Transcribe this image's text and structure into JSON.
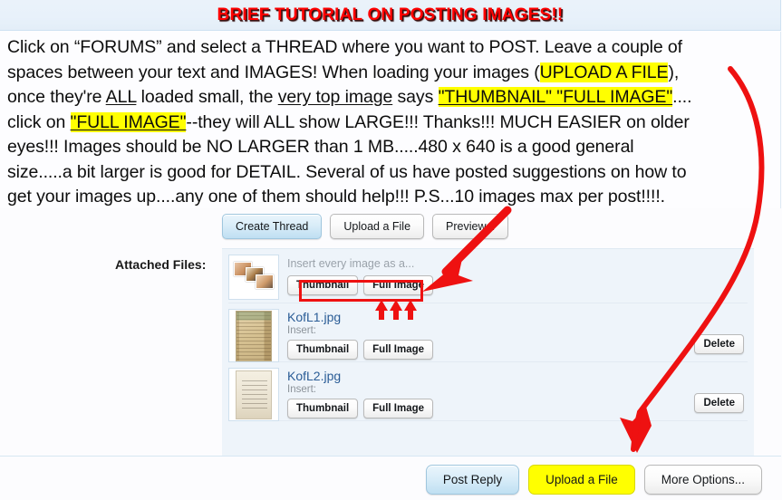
{
  "title": "BRIEF TUTORIAL ON POSTING IMAGES!!",
  "title_color": "#ff0000",
  "highlight_color": "#ffff00",
  "annotation_color": "#ee1111",
  "body_lines": {
    "l1": "Click on “FORUMS” and select a THREAD where you want to POST.  Leave a couple of",
    "l2_a": "spaces between your text and IMAGES!  When loading your images (",
    "l2_hl": "UPLOAD A FILE",
    "l2_b": "),",
    "l3_a": "once they're ",
    "l3_ul1": "ALL",
    "l3_b": " loaded small, the ",
    "l3_ul2": "very top image",
    "l3_c": " says ",
    "l3_hl": "\"THUMBNAIL\" \"FULL IMAGE\"",
    "l3_d": "....",
    "l4_a": "click on ",
    "l4_hl": "\"FULL IMAGE\"",
    "l4_b": "--they will ALL show LARGE!!! Thanks!!! MUCH EASIER on older",
    "l5": "eyes!!!  Images should be NO LARGER than 1 MB.....480 x 640 is a good general",
    "l6": "size.....a bit larger is good for DETAIL.  Several of us have posted suggestions on how to",
    "l7": "get your images up....any one of them should help!!!   P.S...10 images max per post!!!!."
  },
  "top_buttons": [
    {
      "label": "Create Thread",
      "style": "blue"
    },
    {
      "label": "Upload a File",
      "style": "plain"
    },
    {
      "label": "Preview...",
      "style": "plain"
    }
  ],
  "attachments": {
    "label": "Attached Files:",
    "insert_all_hint": "Insert every image as a...",
    "insert_hint": "Insert:",
    "thumbnail_label": "Thumbnail",
    "full_image_label": "Full Image",
    "delete_label": "Delete",
    "files": [
      {
        "name": "KofL1.jpg"
      },
      {
        "name": "KofL2.jpg"
      }
    ]
  },
  "bottom_buttons": [
    {
      "label": "Post Reply",
      "style": "blue"
    },
    {
      "label": "Upload a File",
      "style": "yellow"
    },
    {
      "label": "More Options...",
      "style": "plain"
    }
  ]
}
